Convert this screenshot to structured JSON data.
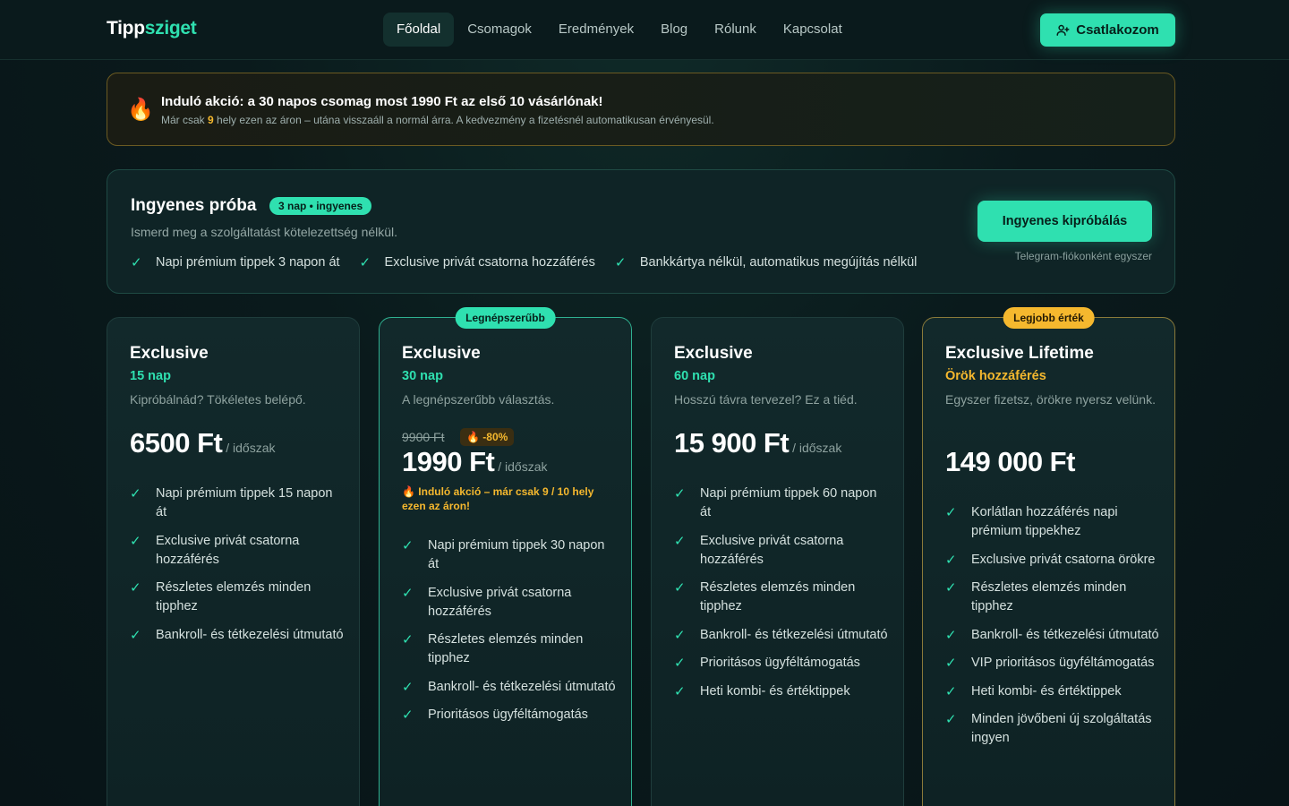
{
  "header": {
    "logo_part1": "Tipp",
    "logo_part2": "sziget",
    "nav": [
      "Főoldal",
      "Csomagok",
      "Eredmények",
      "Blog",
      "Rólunk",
      "Kapcsolat"
    ],
    "join_label": "Csatlakozom"
  },
  "banner": {
    "title": "Induló akció: a 30 napos csomag most 1990 Ft az első 10 vásárlónak!",
    "sub_before": "Már csak ",
    "sub_count": "9",
    "sub_after": " hely ezen az áron – utána visszaáll a normál árra. A kedvezmény a fizetésnél automatikusan érvényesül."
  },
  "trial": {
    "title": "Ingyenes próba",
    "pill": "3 nap • ingyenes",
    "sub": "Ismerd meg a szolgáltatást kötelezettség nélkül.",
    "features": [
      "Napi prémium tippek 3 napon át",
      "Exclusive privát csatorna hozzáférés",
      "Bankkártya nélkül, automatikus megújítás nélkül"
    ],
    "button": "Ingyenes kipróbálás",
    "note": "Telegram-fiókonként egyszer"
  },
  "plans": [
    {
      "name": "Exclusive",
      "duration": "15 nap",
      "desc": "Kipróbálnád? Tökéletes belépő.",
      "price": "6500 Ft",
      "per": " / időszak",
      "features": [
        "Napi prémium tippek 15 napon át",
        "Exclusive privát csatorna hozzáférés",
        "Részletes elemzés minden tipphez",
        "Bankroll- és tétkezelési útmutató"
      ]
    },
    {
      "badge": "Legnépszerűbb",
      "name": "Exclusive",
      "duration": "30 nap",
      "desc": "A legnépszerűbb választás.",
      "old_price": "9900 Ft",
      "discount": "🔥 -80%",
      "price": "1990 Ft",
      "per": " / időszak",
      "promo": "🔥 Induló akció – már csak 9 / 10 hely ezen az áron!",
      "features": [
        "Napi prémium tippek 30 napon át",
        "Exclusive privát csatorna hozzáférés",
        "Részletes elemzés minden tipphez",
        "Bankroll- és tétkezelési útmutató",
        "Prioritásos ügyféltámogatás"
      ]
    },
    {
      "name": "Exclusive",
      "duration": "60 nap",
      "desc": "Hosszú távra tervezel? Ez a tiéd.",
      "price": "15 900 Ft",
      "per": " / időszak",
      "features": [
        "Napi prémium tippek 60 napon át",
        "Exclusive privát csatorna hozzáférés",
        "Részletes elemzés minden tipphez",
        "Bankroll- és tétkezelési útmutató",
        "Prioritásos ügyféltámogatás",
        "Heti kombi- és értéktippek"
      ]
    },
    {
      "badge": "Legjobb érték",
      "name": "Exclusive Lifetime",
      "duration": "Örök hozzáférés",
      "desc": "Egyszer fizetsz, örökre nyersz velünk.",
      "price": "149 000 Ft",
      "features": [
        "Korlátlan hozzáférés napi prémium tippekhez",
        "Exclusive privát csatorna örökre",
        "Részletes elemzés minden tipphez",
        "Bankroll- és tétkezelési útmutató",
        "VIP prioritásos ügyféltámogatás",
        "Heti kombi- és értéktippek",
        "Minden jövőbeni új szolgáltatás ingyen"
      ]
    }
  ],
  "icons": {
    "check": "check-icon",
    "fire": "fire-icon",
    "user_plus": "user-plus-icon"
  },
  "colors": {
    "accent": "#2fe0b0",
    "gold": "#f5b82e",
    "background": "#0a1a1c"
  }
}
